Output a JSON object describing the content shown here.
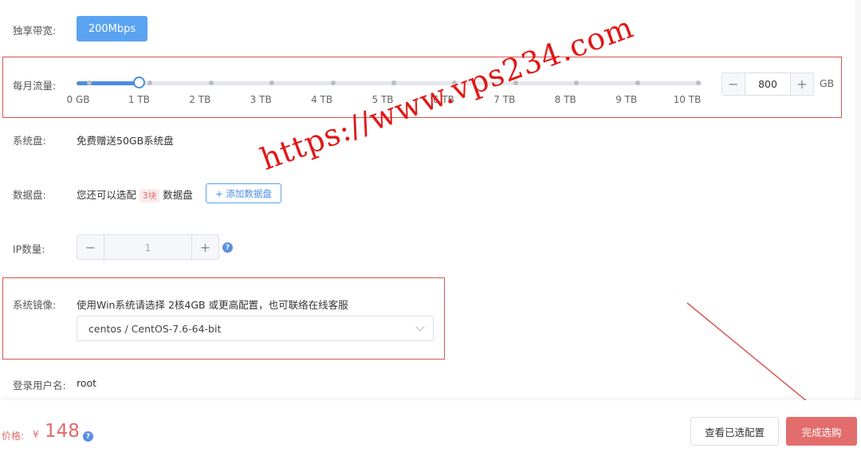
{
  "bandwidth": {
    "label": "独享带宽:",
    "value": "200Mbps"
  },
  "traffic": {
    "label": "每月流量:",
    "ticks": [
      "0 GB",
      "1 TB",
      "2 TB",
      "3 TB",
      "4 TB",
      "5 TB",
      "6 TB",
      "7 TB",
      "8 TB",
      "9 TB",
      "10 TB"
    ],
    "slider_value_fraction": 0.08,
    "value": "800",
    "unit": "GB",
    "minus": "−",
    "plus": "+"
  },
  "system_disk": {
    "label": "系统盘:",
    "text": "免费赠送50GB系统盘"
  },
  "data_disk": {
    "label": "数据盘:",
    "prefix": "您还可以选配",
    "count": "3块",
    "suffix": "数据盘",
    "add_button": "+ 添加数据盘"
  },
  "ip": {
    "label": "IP数量:",
    "value": "1",
    "minus": "−",
    "plus": "+",
    "help": "?"
  },
  "image": {
    "label": "系统镜像:",
    "hint": "使用Win系统请选择 2核4GB 或更高配置，也可联络在线客服",
    "selected": "centos / CentOS-7.6-64-bit"
  },
  "login": {
    "label": "登录用户名:",
    "value": "root"
  },
  "footer": {
    "price_label": "价格:",
    "currency": "¥",
    "price": "148",
    "help": "?",
    "view_config": "查看已选配置",
    "complete": "完成选购"
  },
  "watermark": "https://www.vps234.com",
  "colors": {
    "accent": "#5aa3f2",
    "danger": "#e36c6c",
    "annotation_red": "#d9534f"
  }
}
